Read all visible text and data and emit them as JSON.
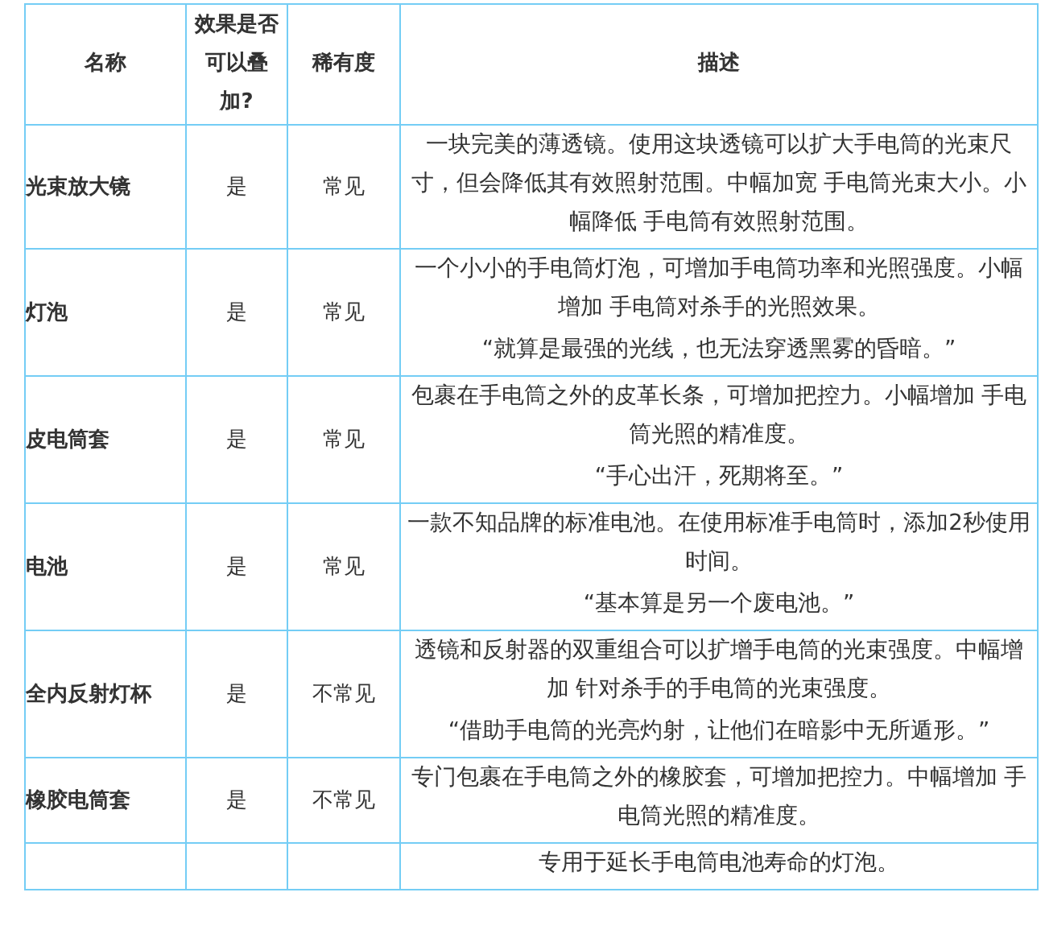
{
  "table": {
    "columns": [
      "名称",
      "效果是否可以叠加?",
      "稀有度",
      "描述"
    ],
    "rows": [
      {
        "name": "光束放大镜",
        "stackable": "是",
        "rarity": "常见",
        "description": [
          "一块完美的薄透镜。使用这块透镜可以扩大手电筒的光束尺寸，但会降低其有效照射范围。中幅加宽 手电筒光束大小。小幅降低 手电筒有效照射范围。"
        ]
      },
      {
        "name": "灯泡",
        "stackable": "是",
        "rarity": "常见",
        "description": [
          "一个小小的手电筒灯泡，可增加手电筒功率和光照强度。小幅增加 手电筒对杀手的光照效果。",
          "“就算是最强的光线，也无法穿透黑雾的昏暗。”"
        ]
      },
      {
        "name": "皮电筒套",
        "stackable": "是",
        "rarity": "常见",
        "description": [
          "包裹在手电筒之外的皮革长条，可增加把控力。小幅增加 手电筒光照的精准度。",
          "“手心出汗，死期将至。”"
        ]
      },
      {
        "name": "电池",
        "stackable": "是",
        "rarity": "常见",
        "description": [
          "一款不知品牌的标准电池。在使用标准手电筒时，添加2秒使用时间。",
          "“基本算是另一个废电池。”"
        ]
      },
      {
        "name": "全内反射灯杯",
        "stackable": "是",
        "rarity": "不常见",
        "description": [
          "透镜和反射器的双重组合可以扩增手电筒的光束强度。中幅增加 针对杀手的手电筒的光束强度。",
          "“借助手电筒的光亮灼射，让他们在暗影中无所遁形。”"
        ]
      },
      {
        "name": "橡胶电筒套",
        "stackable": "是",
        "rarity": "不常见",
        "description": [
          "专门包裹在手电筒之外的橡胶套，可增加把控力。中幅增加 手电筒光照的精准度。"
        ]
      },
      {
        "description": [
          "专用于延长手电筒电池寿命的灯泡。"
        ]
      }
    ]
  }
}
